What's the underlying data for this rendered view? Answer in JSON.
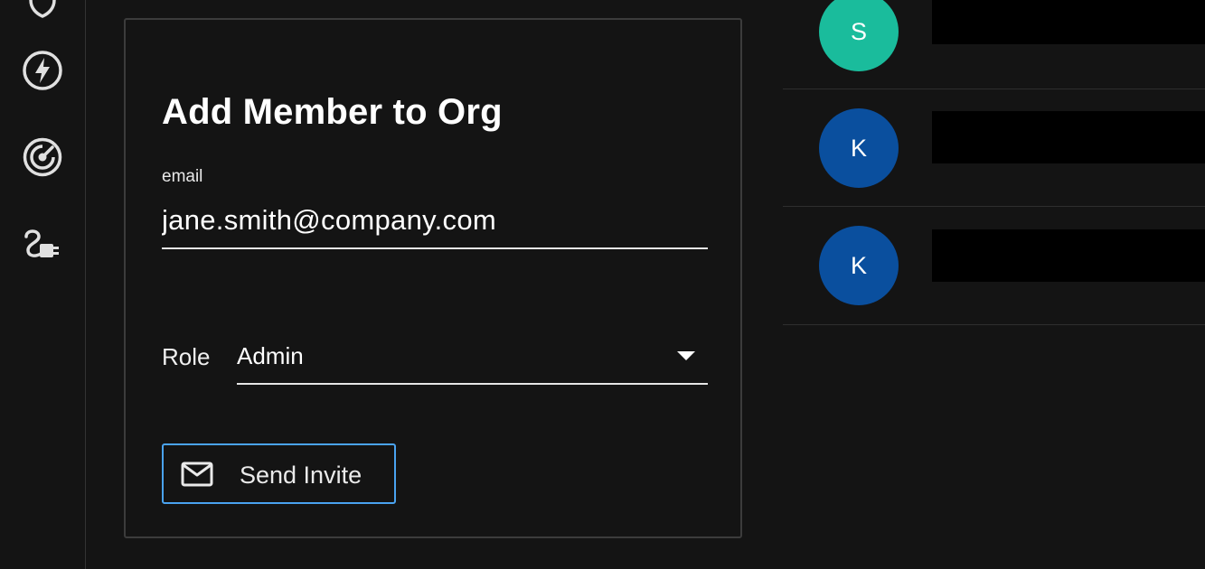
{
  "sidebar": {
    "icons": [
      {
        "name": "shield-icon"
      },
      {
        "name": "lightning-icon"
      },
      {
        "name": "radar-icon"
      },
      {
        "name": "plug-icon"
      }
    ]
  },
  "form": {
    "title": "Add Member to Org",
    "email_label": "email",
    "email_value": "jane.smith@company.com",
    "role_label": "Role",
    "role_value": "Admin",
    "invite_button_label": "Send Invite"
  },
  "members": [
    {
      "initial": "S",
      "color": "#1abc9c"
    },
    {
      "initial": "K",
      "color": "#0a4f9e"
    },
    {
      "initial": "K",
      "color": "#0a4f9e"
    }
  ],
  "colors": {
    "background": "#141414",
    "button_border": "#4aa3f0",
    "avatar_teal": "#1abc9c",
    "avatar_blue": "#0a4f9e"
  }
}
